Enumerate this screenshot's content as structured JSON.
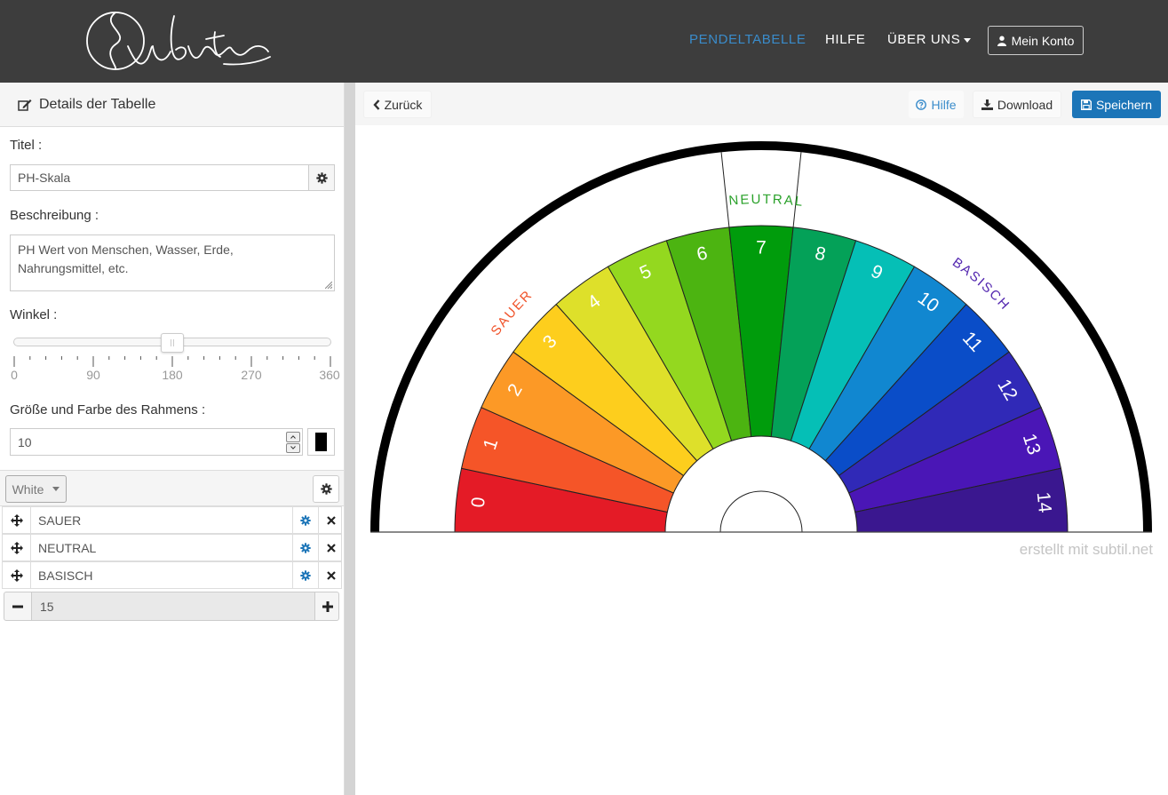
{
  "nav": {
    "items": [
      {
        "label": "PENDELTABELLE",
        "active": true
      },
      {
        "label": "HILFE",
        "active": false
      },
      {
        "label": "ÜBER UNS",
        "active": false
      }
    ],
    "account_label": "Mein Konto",
    "accent_color": "#3a8ccb"
  },
  "panel": {
    "header": "Details der Tabelle",
    "title_label": "Titel :",
    "title_value": "PH-Skala",
    "description_label": "Beschreibung :",
    "description_lines": [
      "PH Wert von Menschen, Wasser, Erde,",
      "Nahrungsmittel, etc."
    ],
    "angle_label": "Winkel :",
    "angle_value": 180,
    "angle_ticks": [
      "0",
      "90",
      "180",
      "270",
      "360"
    ],
    "border_label": "Größe und Farbe des Rahmens :",
    "border_size": "10",
    "border_color": "#000000",
    "theme_dropdown": "White",
    "sections": [
      "SAUER",
      "NEUTRAL",
      "BASISCH"
    ],
    "segment_count": "15"
  },
  "toolbar": {
    "back_label": "Zurück",
    "help_label": "Hilfe",
    "download_label": "Download",
    "save_label": "Speichern"
  },
  "chart": {
    "segments": [
      "0",
      "1",
      "2",
      "3",
      "4",
      "5",
      "6",
      "7",
      "8",
      "9",
      "10",
      "11",
      "12",
      "13",
      "14"
    ],
    "colors": [
      "#e41b26",
      "#f55528",
      "#fc9926",
      "#fdce1d",
      "#dee02a",
      "#94d81f",
      "#4cb411",
      "#009c0c",
      "#04a158",
      "#05bfb6",
      "#1187d0",
      "#0a4dc8",
      "#3029b7",
      "#4a16b6",
      "#3a178f"
    ],
    "section_labels": [
      {
        "text": "SAUER",
        "color": "#f0532a"
      },
      {
        "text": "NEUTRAL",
        "color": "#2aa12a"
      },
      {
        "text": "BASISCH",
        "color": "#5428b0"
      }
    ],
    "watermark": "erstellt mit subtil.net"
  }
}
